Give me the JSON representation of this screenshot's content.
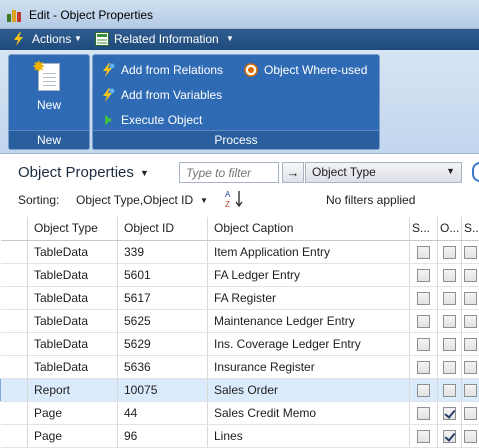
{
  "window": {
    "title": "Edit - Object Properties"
  },
  "menubar": {
    "actions_label": "Actions",
    "related_label": "Related Information"
  },
  "ribbon": {
    "new_group": {
      "label": "New",
      "new_button": "New"
    },
    "process_group": {
      "label": "Process",
      "buttons": [
        "Add from Relations",
        "Add from Variables",
        "Execute Object",
        "Object Where-used"
      ]
    }
  },
  "page": {
    "title": "Object Properties",
    "filter_placeholder": "Type to filter",
    "filter_field": "Object Type",
    "sorting_label": "Sorting:",
    "sorting_value": "Object Type,Object ID",
    "filter_status": "No filters applied"
  },
  "table": {
    "headers": [
      "Object Type",
      "Object ID",
      "Object Caption",
      "S...",
      "O...",
      "S..."
    ],
    "rows": [
      {
        "type": "TableData",
        "id": "339",
        "caption": "Item Application Entry",
        "c1": false,
        "c2": false,
        "c3": false
      },
      {
        "type": "TableData",
        "id": "5601",
        "caption": "FA Ledger Entry",
        "c1": false,
        "c2": false,
        "c3": false
      },
      {
        "type": "TableData",
        "id": "5617",
        "caption": "FA Register",
        "c1": false,
        "c2": false,
        "c3": false
      },
      {
        "type": "TableData",
        "id": "5625",
        "caption": "Maintenance Ledger Entry",
        "c1": false,
        "c2": false,
        "c3": false
      },
      {
        "type": "TableData",
        "id": "5629",
        "caption": "Ins. Coverage Ledger Entry",
        "c1": false,
        "c2": false,
        "c3": false
      },
      {
        "type": "TableData",
        "id": "5636",
        "caption": "Insurance Register",
        "c1": false,
        "c2": false,
        "c3": false
      },
      {
        "type": "Report",
        "id": "10075",
        "caption": "Sales Order",
        "c1": false,
        "c2": false,
        "c3": false
      },
      {
        "type": "Page",
        "id": "44",
        "caption": "Sales Credit Memo",
        "c1": false,
        "c2": true,
        "c3": false
      },
      {
        "type": "Page",
        "id": "96",
        "caption": "Lines",
        "c1": false,
        "c2": true,
        "c3": false
      }
    ],
    "highlighted_row": 6
  },
  "colors": {
    "ribbon_group": "#2f6bb4",
    "menubar": "#1f4a7c",
    "highlight_row": "#dcebfb"
  }
}
